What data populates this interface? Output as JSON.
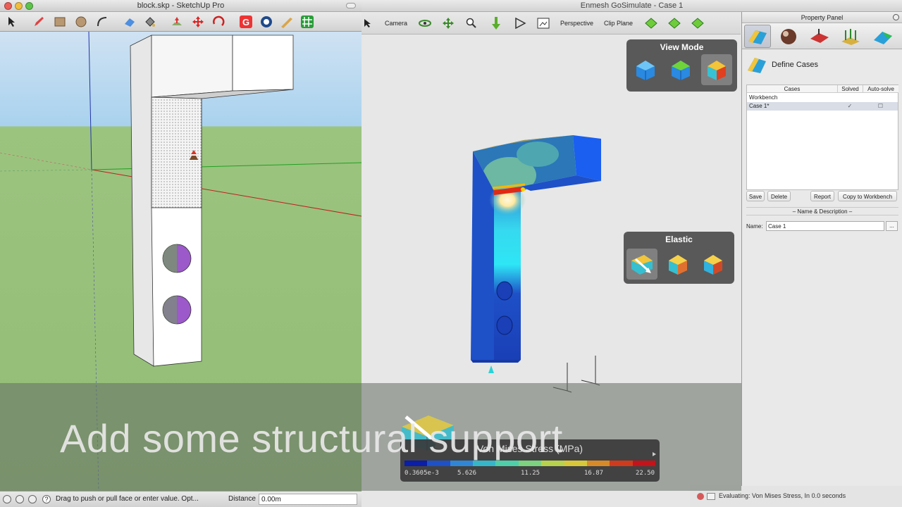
{
  "sketchup": {
    "window_title": "block.skp - SketchUp Pro",
    "status_text": "Drag to push or pull face or enter value.  Opt...",
    "distance_label": "Distance",
    "distance_value": "0.00m",
    "toolbar_icons": [
      "select-icon",
      "pencil-icon",
      "rectangle-icon",
      "circle-icon",
      "arc-icon",
      "eraser-icon",
      "paint-bucket-icon",
      "push-pull-icon",
      "move-icon",
      "rotate-icon",
      "google-g-icon",
      "follow-icon",
      "tape-icon",
      "grid-icon"
    ]
  },
  "gosimulate": {
    "window_title": "Enmesh GoSimulate - Case 1",
    "toolbar": {
      "camera": "Camera",
      "perspective": "Perspective",
      "clip_plane": "Clip Plane"
    },
    "view_mode": {
      "title": "View Mode",
      "buttons": [
        "view-mesh-icon",
        "view-surface-icon",
        "view-results-icon"
      ]
    },
    "elastic": {
      "title": "Elastic",
      "buttons": [
        "load-case-icon",
        "displacement-icon",
        "stress-icon"
      ]
    },
    "status": "Evaluating: Von Mises Stress, In 0.0 seconds",
    "legend": {
      "title": "Von Mises Stress (MPa)",
      "ticks": [
        "0.3605e-3",
        "5.626",
        "11.25",
        "16.87",
        "22.50"
      ],
      "colors": [
        "#0a1ea8",
        "#1e50c8",
        "#2f86d6",
        "#36b6c9",
        "#4fcfa9",
        "#7cd27e",
        "#b7d24d",
        "#d9c73a",
        "#d98a28",
        "#d03b1e",
        "#c4131a"
      ]
    }
  },
  "property_panel": {
    "title": "Property Panel",
    "section_title": "Define Cases",
    "columns": [
      "Cases",
      "Solved",
      "Auto-solve"
    ],
    "rows": [
      {
        "name": "Workbench",
        "solved": "",
        "auto": ""
      },
      {
        "name": "Case 1*",
        "solved": "✓",
        "auto": "☐"
      }
    ],
    "buttons": {
      "save": "Save",
      "delete": "Delete",
      "report": "Report",
      "copy": "Copy to Workbench"
    },
    "name_section": "Name & Description",
    "name_label": "Name:",
    "name_value": "Case 1",
    "ellipsis": "..."
  },
  "caption": "Add some structural support"
}
